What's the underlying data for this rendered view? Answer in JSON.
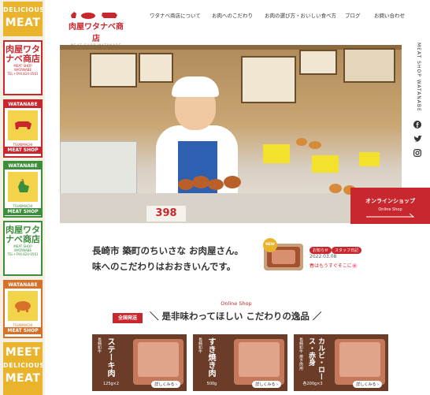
{
  "colors": {
    "brand_red": "#c8282d",
    "gold": "#e9b32c",
    "green": "#3d8e3b",
    "orange": "#d6712a"
  },
  "left_banners": [
    {
      "top": "DELICIOUS",
      "main": "MEAT"
    },
    {
      "kanji": "肉屋ワタナベ商店",
      "sub": "MEAT SHOP WATANABE",
      "tel": "TEL＋FAX.824-0561"
    },
    {
      "top": "WATANABE",
      "animal": "cow-icon",
      "band_label": "TSUKIMACHI",
      "bottom": "MEAT SHOP"
    },
    {
      "top": "WATANABE",
      "animal": "chicken-icon",
      "band_label": "TSUKIMACHI",
      "bottom": "MEAT SHOP"
    },
    {
      "kanji": "肉屋ワタナベ商店",
      "sub": "MEAT SHOP WATANABE",
      "tel": "TEL＋FAX.824-0561"
    },
    {
      "top": "WATANABE",
      "animal": "pig-icon",
      "band_label": "TSUKIMACHI",
      "bottom": "MEAT SHOP"
    },
    {
      "top": "MEET",
      "mid": "DELICIOUS",
      "main": "MEAT"
    }
  ],
  "logo": {
    "main": "肉屋ワタナベ商店",
    "sub": "MEAT SHOP WATANABE"
  },
  "nav": [
    "ワタナベ商店について",
    "お肉へのこだわり",
    "お肉の選び方・おいしい食べ方",
    "ブログ",
    "お問い合わせ"
  ],
  "side": {
    "vertical_text": "MEAT SHOP WATANABE"
  },
  "online_shop": {
    "title": "オンラインショップ",
    "subtitle": "Online Shop"
  },
  "hero": {
    "price": "398"
  },
  "intro": {
    "line1": "長崎市 築町のちいさな お肉屋さん。",
    "line2": "味へのこだわりはおおきいんです。"
  },
  "news": {
    "badge": "NEW",
    "tags": [
      "お知らせ",
      "スタッフ日記"
    ],
    "date": "2022.03.08",
    "title": "春はもうすぐそこに🌸"
  },
  "section": {
    "label": "Online Shop",
    "badge": "全国発送",
    "headline": "＼ 是非味わってほしい こだわりの逸品 ／"
  },
  "products": [
    {
      "small": "長崎和牛",
      "name": "ステーキ肉",
      "weight": "125g×2",
      "more": "詳しくみる ›"
    },
    {
      "small": "長崎和牛",
      "name": "すき焼き肉",
      "weight": "500g",
      "more": "詳しくみる ›"
    },
    {
      "small": "長崎和牛 焼き肉用",
      "name": "カルビ・ロース・赤身",
      "weight": "各200g×3",
      "more": "詳しくみる ›"
    }
  ]
}
